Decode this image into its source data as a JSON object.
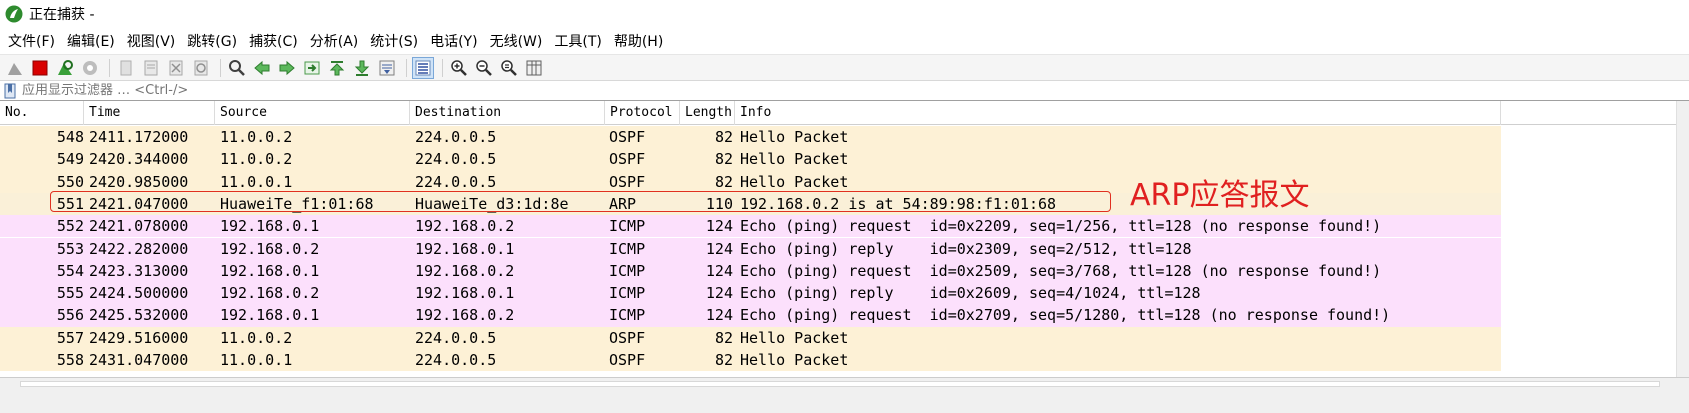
{
  "window": {
    "title": "正在捕获 -"
  },
  "menu": [
    "文件(F)",
    "编辑(E)",
    "视图(V)",
    "跳转(G)",
    "捕获(C)",
    "分析(A)",
    "统计(S)",
    "电话(Y)",
    "无线(W)",
    "工具(T)",
    "帮助(H)"
  ],
  "toolbar": {
    "icons": [
      "shark-fin-start-icon",
      "stop-capture-icon",
      "restart-capture-icon",
      "capture-options-icon",
      "open-file-icon",
      "save-file-icon",
      "close-file-icon",
      "reload-icon",
      "find-packet-icon",
      "go-back-icon",
      "go-forward-icon",
      "go-to-packet-icon",
      "go-first-icon",
      "go-last-icon",
      "autoscroll-icon",
      "colorize-icon",
      "zoom-in-icon",
      "zoom-out-icon",
      "zoom-normal-icon",
      "resize-columns-icon"
    ]
  },
  "filter": {
    "placeholder": "应用显示过滤器 … <Ctrl-/>"
  },
  "columns": {
    "no": "No.",
    "time": "Time",
    "source": "Source",
    "destination": "Destination",
    "protocol": "Protocol",
    "length": "Length",
    "info": "Info"
  },
  "packets": [
    {
      "no": "548",
      "time": "2411.172000",
      "source": "11.0.0.2",
      "destination": "224.0.0.5",
      "protocol": "OSPF",
      "length": "82",
      "info": "Hello Packet",
      "color": "#fdf1d6"
    },
    {
      "no": "549",
      "time": "2420.344000",
      "source": "11.0.0.2",
      "destination": "224.0.0.5",
      "protocol": "OSPF",
      "length": "82",
      "info": "Hello Packet",
      "color": "#fdf1d6"
    },
    {
      "no": "550",
      "time": "2420.985000",
      "source": "11.0.0.1",
      "destination": "224.0.0.5",
      "protocol": "OSPF",
      "length": "82",
      "info": "Hello Packet",
      "color": "#fdf1d6"
    },
    {
      "no": "551",
      "time": "2421.047000",
      "source": "HuaweiTe_f1:01:68",
      "destination": "HuaweiTe_d3:1d:8e",
      "protocol": "ARP",
      "length": "110",
      "info": "192.168.0.2 is at 54:89:98:f1:01:68",
      "color": "#faf0d8"
    },
    {
      "no": "552",
      "time": "2421.078000",
      "source": "192.168.0.1",
      "destination": "192.168.0.2",
      "protocol": "ICMP",
      "length": "124",
      "info": "Echo (ping) request  id=0x2209, seq=1/256, ttl=128 (no response found!)",
      "color": "#fce0fc"
    },
    {
      "no": "553",
      "time": "2422.282000",
      "source": "192.168.0.2",
      "destination": "192.168.0.1",
      "protocol": "ICMP",
      "length": "124",
      "info": "Echo (ping) reply    id=0x2309, seq=2/512, ttl=128",
      "color": "#fce0fc"
    },
    {
      "no": "554",
      "time": "2423.313000",
      "source": "192.168.0.1",
      "destination": "192.168.0.2",
      "protocol": "ICMP",
      "length": "124",
      "info": "Echo (ping) request  id=0x2509, seq=3/768, ttl=128 (no response found!)",
      "color": "#fce0fc"
    },
    {
      "no": "555",
      "time": "2424.500000",
      "source": "192.168.0.2",
      "destination": "192.168.0.1",
      "protocol": "ICMP",
      "length": "124",
      "info": "Echo (ping) reply    id=0x2609, seq=4/1024, ttl=128",
      "color": "#fce0fc"
    },
    {
      "no": "556",
      "time": "2425.532000",
      "source": "192.168.0.1",
      "destination": "192.168.0.2",
      "protocol": "ICMP",
      "length": "124",
      "info": "Echo (ping) request  id=0x2709, seq=5/1280, ttl=128 (no response found!)",
      "color": "#fce0fc"
    },
    {
      "no": "557",
      "time": "2429.516000",
      "source": "11.0.0.2",
      "destination": "224.0.0.5",
      "protocol": "OSPF",
      "length": "82",
      "info": "Hello Packet",
      "color": "#fdf1d6"
    },
    {
      "no": "558",
      "time": "2431.047000",
      "source": "11.0.0.1",
      "destination": "224.0.0.5",
      "protocol": "OSPF",
      "length": "82",
      "info": "Hello Packet",
      "color": "#fdf1d6"
    }
  ],
  "annotation": {
    "text": "ARP应答报文",
    "color": "#e02020"
  }
}
